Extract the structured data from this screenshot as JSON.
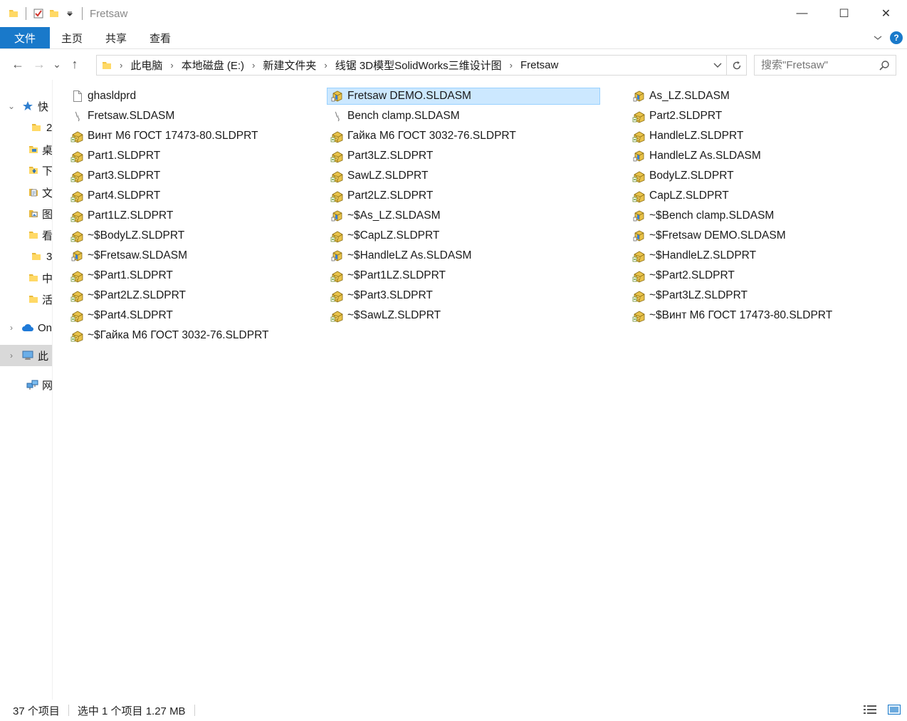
{
  "window": {
    "title": "Fretsaw",
    "minimize_glyph": "—",
    "maximize_glyph": "☐",
    "close_glyph": "✕"
  },
  "ribbon": {
    "tabs": [
      {
        "label": "文件"
      },
      {
        "label": "主页"
      },
      {
        "label": "共享"
      },
      {
        "label": "查看"
      }
    ],
    "help_glyph": "?"
  },
  "nav": {
    "back_glyph": "←",
    "forward_glyph": "→",
    "recent_glyph": "⌄",
    "up_glyph": "↑"
  },
  "address": {
    "crumbs": [
      {
        "label": "此电脑"
      },
      {
        "label": "本地磁盘 (E:)"
      },
      {
        "label": "新建文件夹"
      },
      {
        "label": "线锯 3D模型SolidWorks三维设计图"
      },
      {
        "label": "Fretsaw"
      }
    ],
    "separator": "›"
  },
  "search": {
    "placeholder": "搜索\"Fretsaw\""
  },
  "sidebar": {
    "items": [
      {
        "label": "快",
        "icon": "star-icon",
        "chevron": "⌄"
      },
      {
        "label": "2",
        "icon": "folder-icon"
      },
      {
        "label": "桌",
        "icon": "desktop-folder-icon"
      },
      {
        "label": "下",
        "icon": "download-folder-icon"
      },
      {
        "label": "文",
        "icon": "document-folder-icon"
      },
      {
        "label": "图",
        "icon": "picture-folder-icon"
      },
      {
        "label": "看",
        "icon": "folder-icon"
      },
      {
        "label": "3",
        "icon": "folder-icon"
      },
      {
        "label": "中",
        "icon": "folder-icon"
      },
      {
        "label": "活",
        "icon": "folder-icon"
      },
      {
        "label": "On",
        "icon": "cloud-icon",
        "chevron": "›"
      },
      {
        "label": "此",
        "icon": "computer-icon",
        "chevron": "›"
      },
      {
        "label": "网",
        "icon": "network-icon"
      }
    ]
  },
  "files": {
    "col1": [
      {
        "name": "ghasldprd",
        "icon": "blank-file-icon"
      },
      {
        "name": "Fretsaw.SLDASM",
        "icon": "shortcut-file-icon"
      },
      {
        "name": "Винт М6  ГОСТ 17473-80.SLDPRT",
        "icon": "sldprt-icon"
      },
      {
        "name": "Part1.SLDPRT",
        "icon": "sldprt-icon"
      },
      {
        "name": "Part3.SLDPRT",
        "icon": "sldprt-icon"
      },
      {
        "name": "Part4.SLDPRT",
        "icon": "sldprt-icon"
      },
      {
        "name": "Part1LZ.SLDPRT",
        "icon": "sldprt-icon"
      },
      {
        "name": "~$BodyLZ.SLDPRT",
        "icon": "sldprt-icon"
      },
      {
        "name": "~$Fretsaw.SLDASM",
        "icon": "sldasm-icon"
      },
      {
        "name": "~$Part1.SLDPRT",
        "icon": "sldprt-icon"
      },
      {
        "name": "~$Part2LZ.SLDPRT",
        "icon": "sldprt-icon"
      },
      {
        "name": "~$Part4.SLDPRT",
        "icon": "sldprt-icon"
      },
      {
        "name": "~$Гайка М6 ГОСТ 3032-76.SLDPRT",
        "icon": "sldprt-icon"
      }
    ],
    "col2": [
      {
        "name": "Fretsaw DEMO.SLDASM",
        "icon": "sldasm-icon",
        "selected": true
      },
      {
        "name": "Bench clamp.SLDASM",
        "icon": "shortcut-file-icon"
      },
      {
        "name": "Гайка М6 ГОСТ 3032-76.SLDPRT",
        "icon": "sldprt-icon"
      },
      {
        "name": "Part3LZ.SLDPRT",
        "icon": "sldprt-icon"
      },
      {
        "name": "SawLZ.SLDPRT",
        "icon": "sldprt-icon"
      },
      {
        "name": "Part2LZ.SLDPRT",
        "icon": "sldprt-icon"
      },
      {
        "name": "~$As_LZ.SLDASM",
        "icon": "sldasm-icon"
      },
      {
        "name": "~$CapLZ.SLDPRT",
        "icon": "sldprt-icon"
      },
      {
        "name": "~$HandleLZ As.SLDASM",
        "icon": "sldasm-icon"
      },
      {
        "name": "~$Part1LZ.SLDPRT",
        "icon": "sldprt-icon"
      },
      {
        "name": "~$Part3.SLDPRT",
        "icon": "sldprt-icon"
      },
      {
        "name": "~$SawLZ.SLDPRT",
        "icon": "sldprt-icon"
      }
    ],
    "col3": [
      {
        "name": "As_LZ.SLDASM",
        "icon": "sldasm-icon"
      },
      {
        "name": "Part2.SLDPRT",
        "icon": "sldprt-icon"
      },
      {
        "name": "HandleLZ.SLDPRT",
        "icon": "sldprt-icon"
      },
      {
        "name": "HandleLZ As.SLDASM",
        "icon": "sldasm-icon"
      },
      {
        "name": "BodyLZ.SLDPRT",
        "icon": "sldprt-icon"
      },
      {
        "name": "CapLZ.SLDPRT",
        "icon": "sldprt-icon"
      },
      {
        "name": "~$Bench clamp.SLDASM",
        "icon": "sldasm-icon"
      },
      {
        "name": "~$Fretsaw DEMO.SLDASM",
        "icon": "sldasm-icon"
      },
      {
        "name": "~$HandleLZ.SLDPRT",
        "icon": "sldprt-icon"
      },
      {
        "name": "~$Part2.SLDPRT",
        "icon": "sldprt-icon"
      },
      {
        "name": "~$Part3LZ.SLDPRT",
        "icon": "sldprt-icon"
      },
      {
        "name": "~$Винт М6  ГОСТ 17473-80.SLDPRT",
        "icon": "sldprt-icon"
      }
    ]
  },
  "status": {
    "count": "37 个项目",
    "selection": "选中 1 个项目  1.27 MB"
  },
  "colors": {
    "accent": "#1979ca",
    "selection_bg": "#cce8ff",
    "selection_border": "#99d1ff"
  }
}
